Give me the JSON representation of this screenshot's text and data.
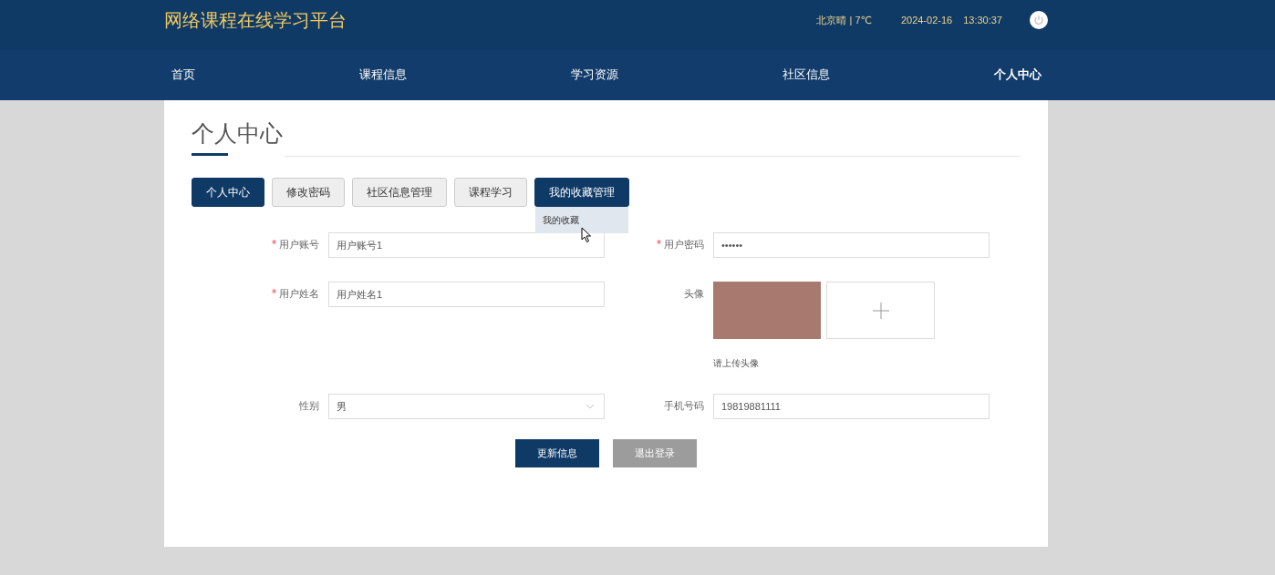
{
  "header": {
    "logo": "网络课程在线学习平台",
    "weather": "北京晴 | 7℃",
    "date": "2024-02-16",
    "time": "13:30:37"
  },
  "nav": [
    {
      "label": "首页",
      "selected": false
    },
    {
      "label": "课程信息",
      "selected": false
    },
    {
      "label": "学习资源",
      "selected": false
    },
    {
      "label": "社区信息",
      "selected": false
    },
    {
      "label": "个人中心",
      "selected": true
    }
  ],
  "page_title": "个人中心",
  "tabs": [
    {
      "label": "个人中心",
      "selected": true
    },
    {
      "label": "修改密码",
      "selected": false
    },
    {
      "label": "社区信息管理",
      "selected": false
    },
    {
      "label": "课程学习",
      "selected": false
    },
    {
      "label": "我的收藏管理",
      "selected": true,
      "expanded": true,
      "menu": [
        {
          "label": "我的收藏"
        }
      ]
    }
  ],
  "form": {
    "fields": [
      {
        "kind": "text",
        "label": "用户账号",
        "required": true,
        "value": "用户账号1"
      },
      {
        "kind": "text",
        "label": "用户密码",
        "required": true,
        "value": "••••••"
      },
      {
        "kind": "text",
        "label": "用户姓名",
        "required": true,
        "value": "用户姓名1"
      },
      {
        "kind": "image",
        "label": "头像",
        "required": false,
        "hint": "请上传头像"
      },
      {
        "kind": "select",
        "label": "性别",
        "required": false,
        "value": "男"
      },
      {
        "kind": "text",
        "label": "手机号码",
        "required": false,
        "value": "19819881111"
      }
    ],
    "buttons": [
      {
        "label": "更新信息",
        "kind": "primary"
      },
      {
        "label": "退出登录",
        "kind": "secondary"
      }
    ]
  }
}
